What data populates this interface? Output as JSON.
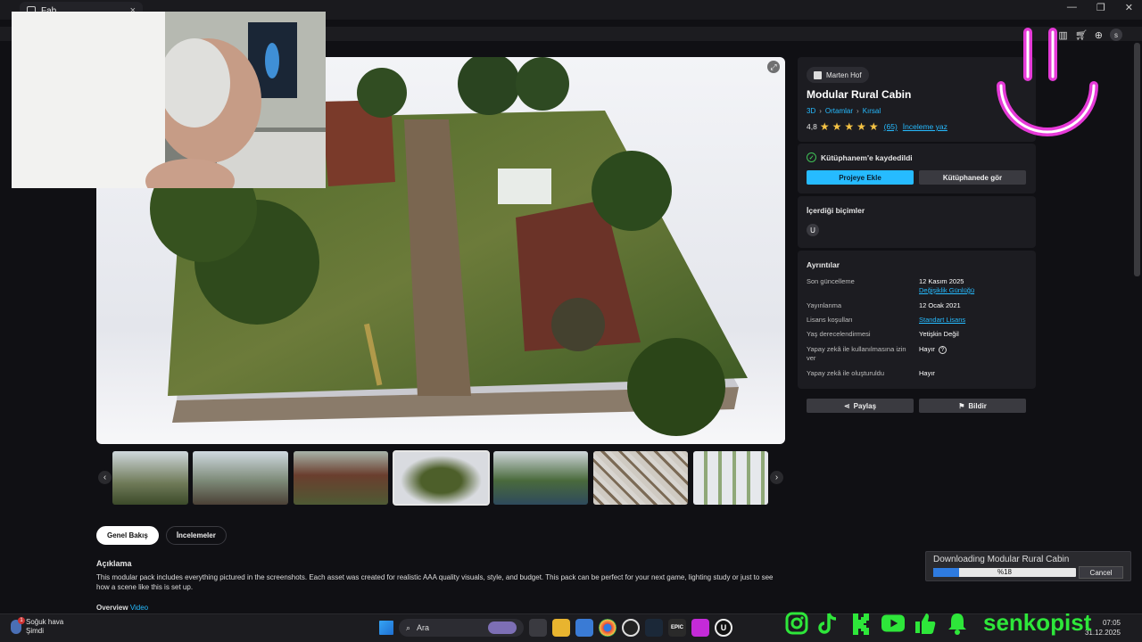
{
  "browser": {
    "tab_title": "Fab",
    "win_min": "—",
    "win_max": "❐",
    "win_close": "✕"
  },
  "product": {
    "seller": "Marten Hof",
    "title": "Modular Rural Cabin",
    "breadcrumbs": [
      "3D",
      "Ortamlar",
      "Kırsal"
    ],
    "rating": "4,8",
    "stars": 5,
    "review_count": "(65)",
    "write_review": "İnceleme yaz"
  },
  "library": {
    "saved_text": "Kütüphanem'e kaydedildi",
    "add_to_project": "Projeye Ekle",
    "view_in_library": "Kütüphanede gör"
  },
  "formats": {
    "heading": "İçerdiği biçimler",
    "icon": "unreal-engine-icon"
  },
  "details": {
    "heading": "Ayrıntılar",
    "rows": [
      {
        "key": "Son güncelleme",
        "value": "12 Kasım 2025",
        "link": "Değişiklik Günlüğü"
      },
      {
        "key": "Yayınlanma",
        "value": "12 Ocak 2021"
      },
      {
        "key": "Lisans koşulları",
        "link": "Standart Lisans"
      },
      {
        "key": "Yaş derecelendirmesi",
        "value": "Yetişkin Değil"
      },
      {
        "key": "Yapay zekâ ile kullanılmasına izin ver",
        "value": "Hayır"
      },
      {
        "key": "Yapay zekâ ile oluşturuldu",
        "value": "Hayır"
      }
    ],
    "share": "Paylaş",
    "report": "Bildir"
  },
  "content_tabs": [
    "Genel Bakış",
    "İncelemeler"
  ],
  "description": {
    "heading": "Açıklama",
    "text": "This modular pack includes everything pictured in the screenshots. Each asset was created for realistic AAA quality visuals, style, and budget. This pack can be perfect for your next game, lighting study or just to see how a scene like this is set up.",
    "overview_label": "Overview",
    "overview_link": "Video"
  },
  "download": {
    "title": "Downloading Modular Rural Cabin",
    "progress": 0.18,
    "progress_text": "%18",
    "cancel": "Cancel"
  },
  "taskbar": {
    "weather_title": "Soğuk hava",
    "weather_sub": "Şimdi",
    "search": "Ara",
    "time": "07:05",
    "date": "31.12.2025"
  },
  "overlay": {
    "brand": "senkopist"
  },
  "colors": {
    "accent": "#26bbff",
    "panel": "#1c1c21",
    "star": "#f6c344",
    "brand_green": "#2ee63a",
    "smile_pink": "#e63ad8"
  }
}
